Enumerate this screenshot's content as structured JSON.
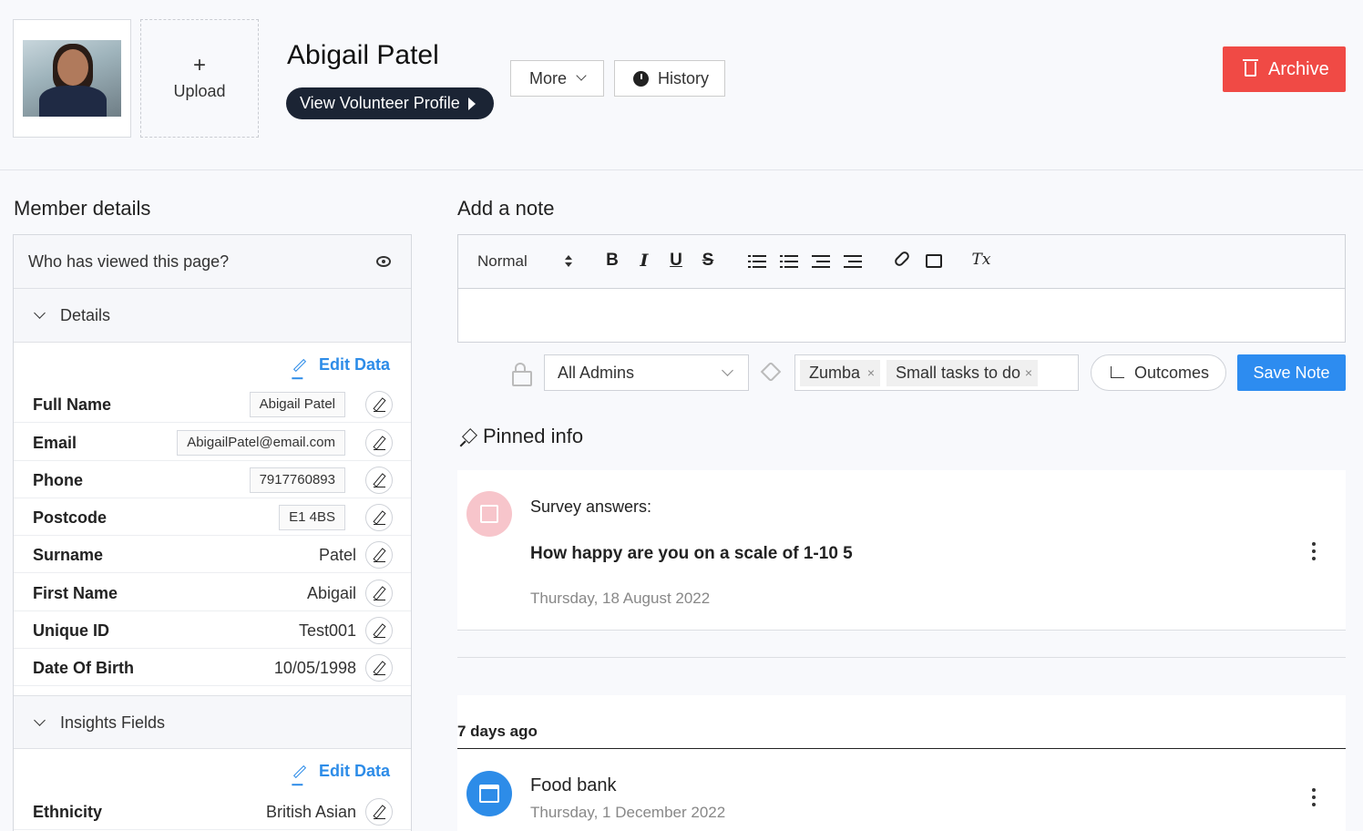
{
  "header": {
    "upload_plus": "+",
    "upload_label": "Upload",
    "name": "Abigail Patel",
    "volunteer_btn": "View Volunteer Profile",
    "more_btn": "More",
    "history_btn": "History",
    "archive_btn": "Archive",
    "archive_color": "#f04a45"
  },
  "member": {
    "title": "Member details",
    "viewed": "Who has viewed this page?",
    "details_label": "Details",
    "edit_data": "Edit Data",
    "fields": [
      {
        "label": "Full Name",
        "value": "Abigail Patel",
        "boxed": true
      },
      {
        "label": "Email",
        "value": "AbigailPatel@email.com",
        "boxed": true
      },
      {
        "label": "Phone",
        "value": "7917760893",
        "boxed": true
      },
      {
        "label": "Postcode",
        "value": "E1 4BS",
        "boxed": true
      },
      {
        "label": "Surname",
        "value": "Patel",
        "boxed": false
      },
      {
        "label": "First Name",
        "value": "Abigail",
        "boxed": false
      },
      {
        "label": "Unique ID",
        "value": "Test001",
        "boxed": false
      },
      {
        "label": "Date Of Birth",
        "value": "10/05/1998",
        "boxed": false
      }
    ],
    "insights_label": "Insights Fields",
    "insights_edit": "Edit Data",
    "insights_fields": [
      {
        "label": "Ethnicity",
        "value": "British Asian"
      }
    ]
  },
  "note": {
    "title": "Add a note",
    "format": "Normal",
    "toolbar": {
      "bold": "B",
      "italic": "I",
      "underline": "U",
      "strike": "S",
      "clear": "Tx"
    },
    "visibility": "All Admins",
    "tags": [
      {
        "label": "Zumba"
      },
      {
        "label": "Small tasks to do"
      }
    ],
    "chip_remove": "×",
    "outcomes_btn": "Outcomes",
    "save_btn": "Save Note",
    "accent": "#2d8cf0"
  },
  "pinned": {
    "title": "Pinned info",
    "card": {
      "heading": "Survey answers:",
      "question": "How happy are you on a scale of 1-10 5",
      "date": "Thursday, 18 August 2022"
    }
  },
  "timeline": {
    "group": "7 days ago",
    "items": [
      {
        "title": "Food bank",
        "date": "Thursday, 1 December 2022"
      }
    ]
  }
}
